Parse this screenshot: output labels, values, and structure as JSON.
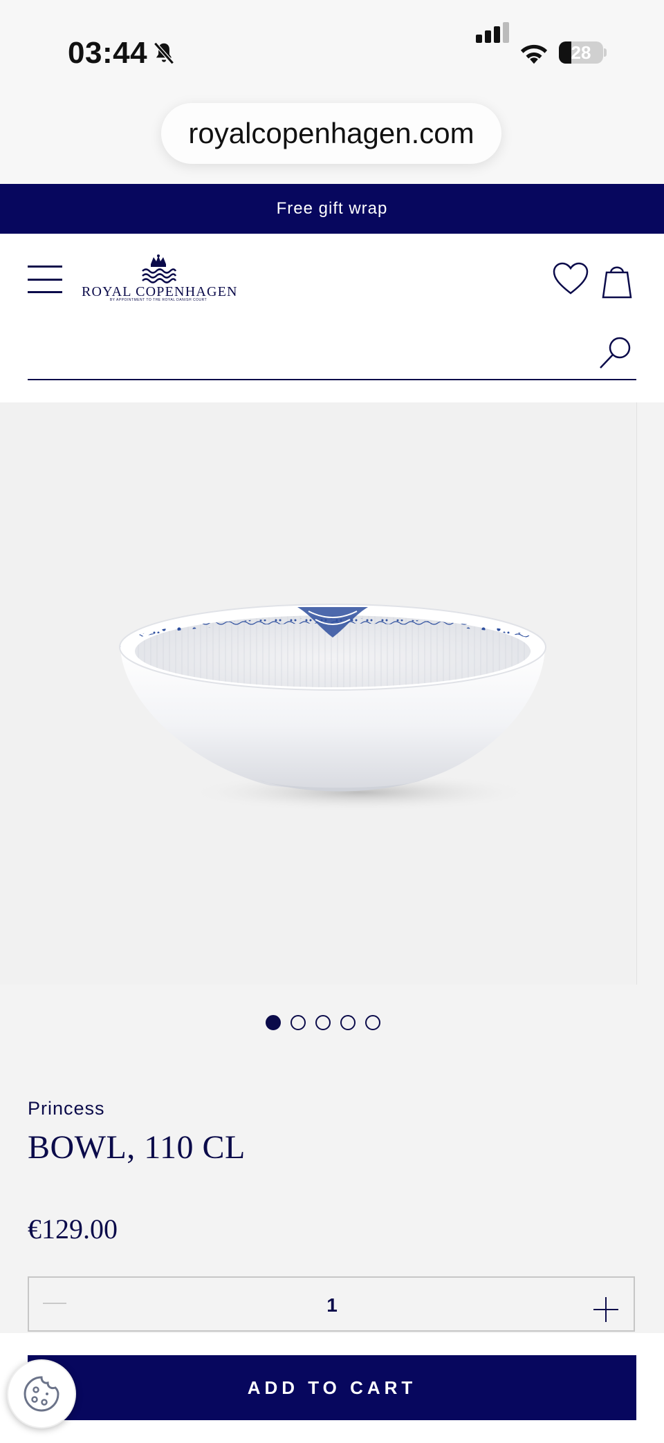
{
  "status_bar": {
    "time": "03:44",
    "battery": "28",
    "battery_level": 0.28,
    "icons": [
      "bell-slash-icon",
      "signal-icon",
      "wifi-icon",
      "battery-icon"
    ]
  },
  "browser": {
    "url": "royalcopenhagen.com"
  },
  "promo": {
    "text": "Free gift wrap"
  },
  "header": {
    "logo_text": "ROYAL COPENHAGEN",
    "logo_subtext": "BY APPOINTMENT TO THE ROYAL DANISH COURT",
    "icons": [
      "menu-icon",
      "crown-icon",
      "heart-icon",
      "bag-icon",
      "search-icon"
    ],
    "search": {
      "value": "",
      "placeholder": ""
    }
  },
  "gallery": {
    "image": "bowl-image",
    "dots_total": 5,
    "active_index": 0
  },
  "product": {
    "collection": "Princess",
    "title": "BOWL, 110 CL",
    "price": "€129.00",
    "quantity": "1"
  },
  "actions": {
    "add_to_cart": "ADD TO CART",
    "cookie_icon": "cookie-icon"
  },
  "colors": {
    "brand_navy": "#07075e",
    "text_navy": "#0b0b4a",
    "background": "#f3f3f3"
  }
}
